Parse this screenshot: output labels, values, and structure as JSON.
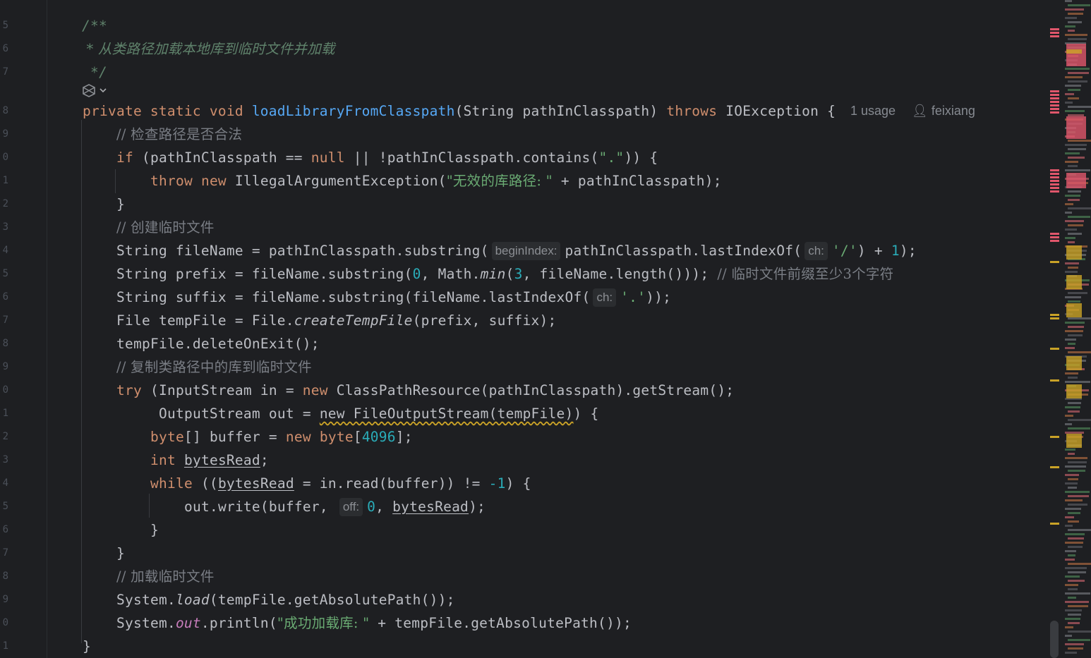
{
  "gutter": {
    "line_numbers": [
      "5",
      "6",
      "7",
      "8",
      "9",
      "0",
      "1",
      "2",
      "3",
      "4",
      "5",
      "6",
      "7",
      "8",
      "9",
      "0",
      "1",
      "2",
      "3",
      "4",
      "5",
      "6",
      "7",
      "8",
      "9",
      "0",
      "1"
    ]
  },
  "doc_comment": {
    "open": "/**",
    "text": " * 从类路径加载本地库到临时文件并加载",
    "close": " */"
  },
  "method": {
    "modifiers": "private static void ",
    "name": "loadLibraryFromClasspath",
    "params": "(String pathInClasspath) ",
    "throws_kw": "throws",
    "throws_type": " IOException {",
    "usage_hint": "1 usage",
    "author_icon": "person-icon",
    "author": "feixiang"
  },
  "code": {
    "c1": "// 检查路径是否合法",
    "if_kw": "if",
    "if_a": " (pathInClasspath == ",
    "null_kw": "null",
    "if_b": " || !pathInClasspath.contains(",
    "if_str": "\".\"",
    "if_c": ")) {",
    "throw_kw": "throw",
    "new_kw": "new",
    "throw_a": " IllegalArgumentException(",
    "throw_str": "\"无效的库路径: \"",
    "throw_b": " + pathInClasspath);",
    "close_brace": "}",
    "c2": "// 创建临时文件",
    "fn_a": "String fileName = pathInClasspath.substring(",
    "hint_begin": "beginIndex:",
    "fn_b": "pathInClasspath.lastIndexOf(",
    "hint_ch": "ch:",
    "fn_str": "'/'",
    "fn_c": ") + ",
    "fn_num": "1",
    "fn_d": ");",
    "pf_a": "String prefix = fileName.substring(",
    "pf_num0": "0",
    "pf_b": ", Math.",
    "pf_min": "min",
    "pf_c": "(",
    "pf_num3": "3",
    "pf_d": ", fileName.length())); ",
    "pf_comment": "// 临时文件前缀至少3个字符",
    "sf_a": "String suffix = fileName.substring(fileName.lastIndexOf(",
    "sf_str": "'.'",
    "sf_b": "));",
    "tf_a": "File tempFile = File.",
    "tf_create": "createTempFile",
    "tf_b": "(prefix, suffix);",
    "del": "tempFile.deleteOnExit();",
    "c3": "// 复制类路径中的库到临时文件",
    "try_kw": "try",
    "try_a": " (InputStream in = ",
    "try_b": " ClassPathResource(pathInClasspath).getStream();",
    "out_a": " OutputStream out = ",
    "out_new_stmt": "new FileOutputStream(tempFile)",
    "out_b": ") {",
    "byte_kw": "byte",
    "byte_a": "[] buffer = ",
    "byte_b": " ",
    "byte_c": "[",
    "byte_num": "4096",
    "byte_d": "];",
    "int_kw": "int",
    "int_var": "bytesRead",
    "int_end": ";",
    "while_kw": "while",
    "while_a": " ((",
    "while_var": "bytesRead",
    "while_b": " = in.read(buffer)) != ",
    "while_num": "-1",
    "while_c": ") {",
    "write_a": "out.write(buffer, ",
    "hint_off": "off:",
    "write_num": "0",
    "write_b": ", ",
    "write_var": "bytesRead",
    "write_c": ");",
    "c4": "// 加载临时文件",
    "load_a": "System.",
    "load_fn": "load",
    "load_b": "(tempFile.getAbsolutePath());",
    "print_a": "System.",
    "print_out": "out",
    "print_b": ".println(",
    "print_str": "\"成功加载库: \"",
    "print_c": " + tempFile.getAbsolutePath());",
    "final_brace": "}"
  },
  "ai_icon": "ai-assistant-icon",
  "colors": {
    "background": "#1e1f22",
    "keyword": "#cf8e6d",
    "function": "#56a8f5",
    "string": "#6aab73",
    "number": "#2aacb8",
    "comment": "#7a7e85",
    "doc_comment": "#5f826b",
    "static_field": "#c77dbb",
    "text": "#bcbec4"
  }
}
